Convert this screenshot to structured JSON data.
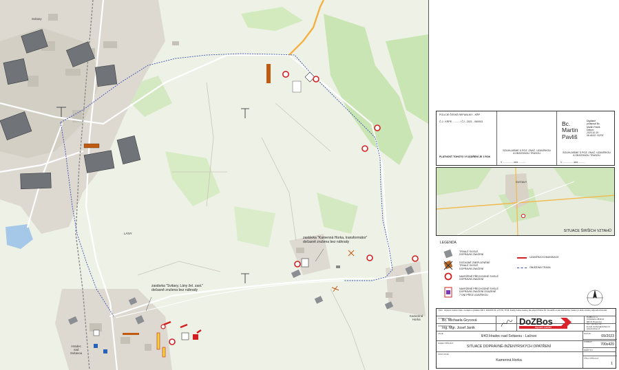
{
  "map": {
    "stop1_label": "zastávka \"Svitavy, Lány žel. zast.\"\ndočasně zrušena bez náhrady",
    "stop2_label": "zastávka \"Kamenná Horka, transformátor\"\ndočasně zrušena bez náhrady",
    "place_hradec": "Hradec\nnad\nSvitavou",
    "place_kamenna": "Kamenná\nHorka",
    "place_lany": "LÁNY",
    "place_svitavy": "Svitavy"
  },
  "approval": {
    "police_header": "POLICIE ČESKÉ REPUBLIKY - KŘP",
    "cj_line": "Č.J.: KRPE - ........ / ČJ - 2021 - 060003",
    "validity": "PLATNOST TOHOTO VYJÁDŘENÍ JE 1 ROK",
    "agreement1": "SOUHLASÍME S POZ. ZNAČ. UZAVÍRKOU\nA OBJÍZDNOU TRASOU",
    "agreement2": "SOUHLASÍME S POZ. ZNAČ. UZAVÍRKOU\nA OBJÍZDNOU TRASOU",
    "date_prefix": "V",
    "date_word": "dne",
    "signature_name": "Bc.\nMartin\nPavliš",
    "signature_text": "Digitálně\npodepsal Bc.\nMartin Pavliš\nDatum:\n2023.10.19\n06:46:42 +02'00'"
  },
  "overview": {
    "title": "SITUACE ŠIRŠÍCH VZTAHŮ",
    "town": "SVITAVY"
  },
  "legend": {
    "title": "LEGENDA",
    "items": [
      "TRVALÉ SVISLÉ\nDOPRAVNÍ ZNAČENÍ",
      "DOČASNĚ ZNEPLATNĚNÉ\nTRVALÉ SVISLÉ\nDOPRAVNÍ ZNAČENÍ",
      "NAVRŽENÉ PŘECHODNÉ SVISLÉ\nDOPRAVNÍ ZNAČENÍ",
      "NAVRŽENÉ PŘECHODNÉ SVISLÉ\nDOPRAVNÍ ZNAČENÍ OSAZENÉ\n7 DNÍ PŘED UZAVÍRKOU"
    ],
    "closure": "UZAVÍRKA KOMUNIKACE",
    "detour": "OBJÍZDNÁ TRASA"
  },
  "titleblock": {
    "note": "Pozn.: dopravní značení bude v souladu s vyhláškou MD č. 294/2015 Sb. a TP 65, TP 66. Značky budou osazeny dle pokynů Policie ČR. Za údržbu a stav dopravního značení po dobu uzavírky odpovídá zhotovitel.",
    "author_caption": "VYPRACOVAL:",
    "author": "Bc. Michaela Grycová",
    "checker_caption": "KONTROLOVAL:",
    "checker": "Ing. Mgr. Josef Janík",
    "company_name": "DoZBos",
    "company_sub": "dopravní značení",
    "company_address": "DoZBos s.r.o.\nVrchlického 2841/12\n680 01 Boskovice\nTel.: 736 514 754\nE-mail: dozbos@dozbos.cz\nwww.dozbos.cz",
    "project_caption": "AKCE:",
    "project": "II/43 Hradec nad Svitavou - Lačnov",
    "drawing_caption": "NÁZEV PŘÍLOHY:",
    "drawing": "SITUACE DOPRAVNĚ-INŽENÝRSKÝCH OPATŘENÍ",
    "part_caption": "ČÁST AKCE:",
    "part": "Kamenná Horka",
    "date_caption": "DATUM:",
    "date": "09/2023",
    "format_caption": "FORMÁT:",
    "format": "700x420",
    "scale_caption": "MĚŘÍTKO:",
    "scale": "",
    "number_caption": "ČÍSLO PŘÍLOHY:",
    "number": "1"
  },
  "colors": {
    "detour": "#3a4fb4",
    "closure": "#d21f1f",
    "brand": "#d8232a",
    "map_bg": "#eef2e6",
    "urban": "#d9d5cc",
    "forest": "#c7e3b0",
    "water": "#a6c8e8"
  },
  "icons": {
    "north": "north-arrow-icon",
    "sign": "traffic-sign-icon",
    "brand_arrow": "chevron-right-icon"
  }
}
